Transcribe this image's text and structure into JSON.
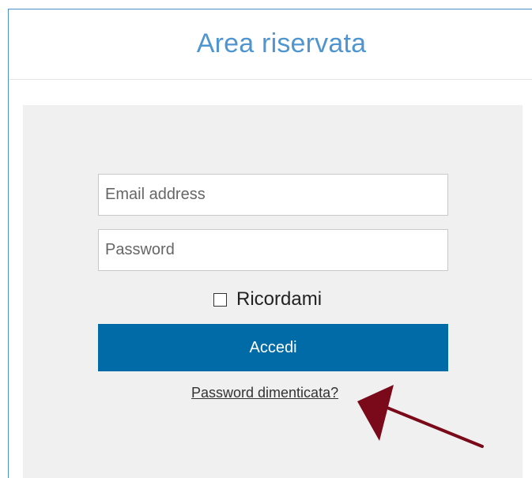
{
  "header": {
    "title": "Area riservata"
  },
  "login": {
    "email_placeholder": "Email address",
    "password_placeholder": "Password",
    "remember_label": "Ricordami",
    "remember_checked": false,
    "submit_label": "Accedi",
    "forgot_label": "Password dimenticata?"
  },
  "colors": {
    "title": "#4f95d0",
    "button": "#006ba6",
    "panel": "#f0f0f0",
    "annotation_arrow": "#7a0a1a"
  },
  "annotation": {
    "icon": "arrow-icon"
  }
}
